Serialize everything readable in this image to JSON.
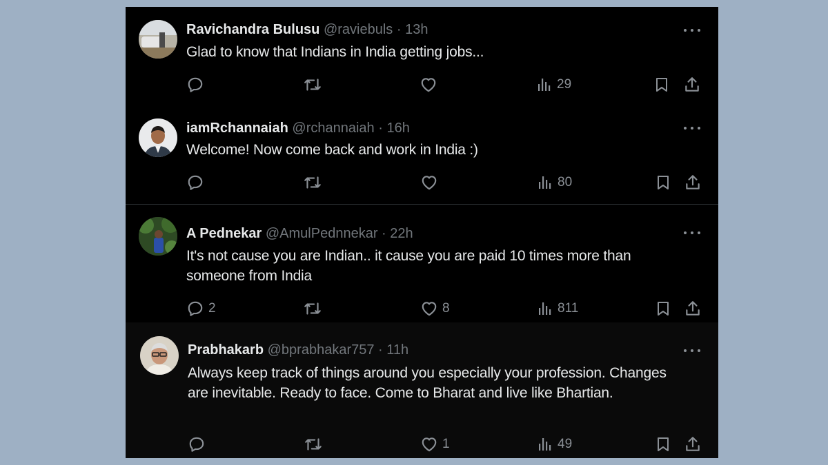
{
  "tweets": [
    {
      "name": "Ravichandra Bulusu",
      "handle": "@raviebuls",
      "sep": "·",
      "time": "13h",
      "text": "Glad to know that Indians in India getting jobs...",
      "replies": "",
      "retweets": "",
      "likes": "",
      "views": "29"
    },
    {
      "name": "iamRchannaiah",
      "handle": "@rchannaiah",
      "sep": "·",
      "time": "16h",
      "text": "Welcome! Now come back and work in India :)",
      "replies": "",
      "retweets": "",
      "likes": "",
      "views": "80"
    },
    {
      "name": "A Pednekar",
      "handle": "@AmulPednnekar",
      "sep": "·",
      "time": "22h",
      "text": "It's not cause you are Indian.. it cause you are paid 10 times more than someone from India",
      "replies": "2",
      "retweets": "",
      "likes": "8",
      "views": "811"
    },
    {
      "name": "Prabhakarb",
      "handle": "@bprabhakar757",
      "sep": "·",
      "time": "11h",
      "text": "Always keep track of things around you especially your profession. Changes are inevitable. Ready to face. Come to Bharat and live like Bhartian.",
      "replies": "",
      "retweets": "",
      "likes": "1",
      "views": "49"
    }
  ],
  "icons": {
    "reply": "reply-icon",
    "retweet": "retweet-icon",
    "like": "heart-icon",
    "views": "views-icon",
    "bookmark": "bookmark-icon",
    "share": "share-icon",
    "more": "more-icon"
  },
  "colors": {
    "background": "#000000",
    "page": "#9eb0c4",
    "text": "#e7e9ea",
    "muted": "#71767b"
  }
}
